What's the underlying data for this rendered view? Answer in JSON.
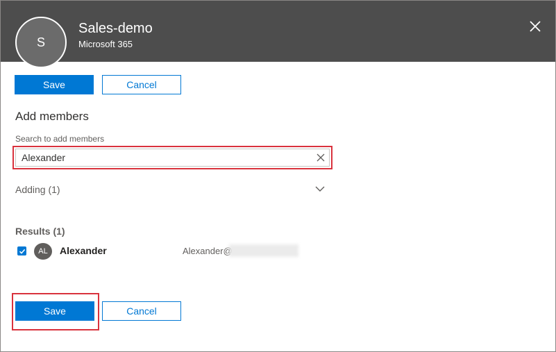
{
  "header": {
    "avatar_initial": "S",
    "group_name": "Sales-demo",
    "group_type": "Microsoft 365",
    "close_icon": "close-icon",
    "background_color": "#4d4d4d"
  },
  "top_actions": {
    "save_label": "Save",
    "cancel_label": "Cancel"
  },
  "add_members": {
    "title": "Add members",
    "search_label": "Search to add members",
    "search_value": "Alexander",
    "clear_icon": "clear-icon",
    "adding_label": "Adding (1)",
    "adding_icon": "chevron-down-icon"
  },
  "results": {
    "label": "Results (1)",
    "items": [
      {
        "checked": true,
        "initials": "AL",
        "name": "Alexander",
        "email_visible": "Alexander@"
      }
    ]
  },
  "bottom_actions": {
    "save_label": "Save",
    "cancel_label": "Cancel"
  },
  "colors": {
    "accent": "#0078d4",
    "highlight": "#d9323d"
  }
}
